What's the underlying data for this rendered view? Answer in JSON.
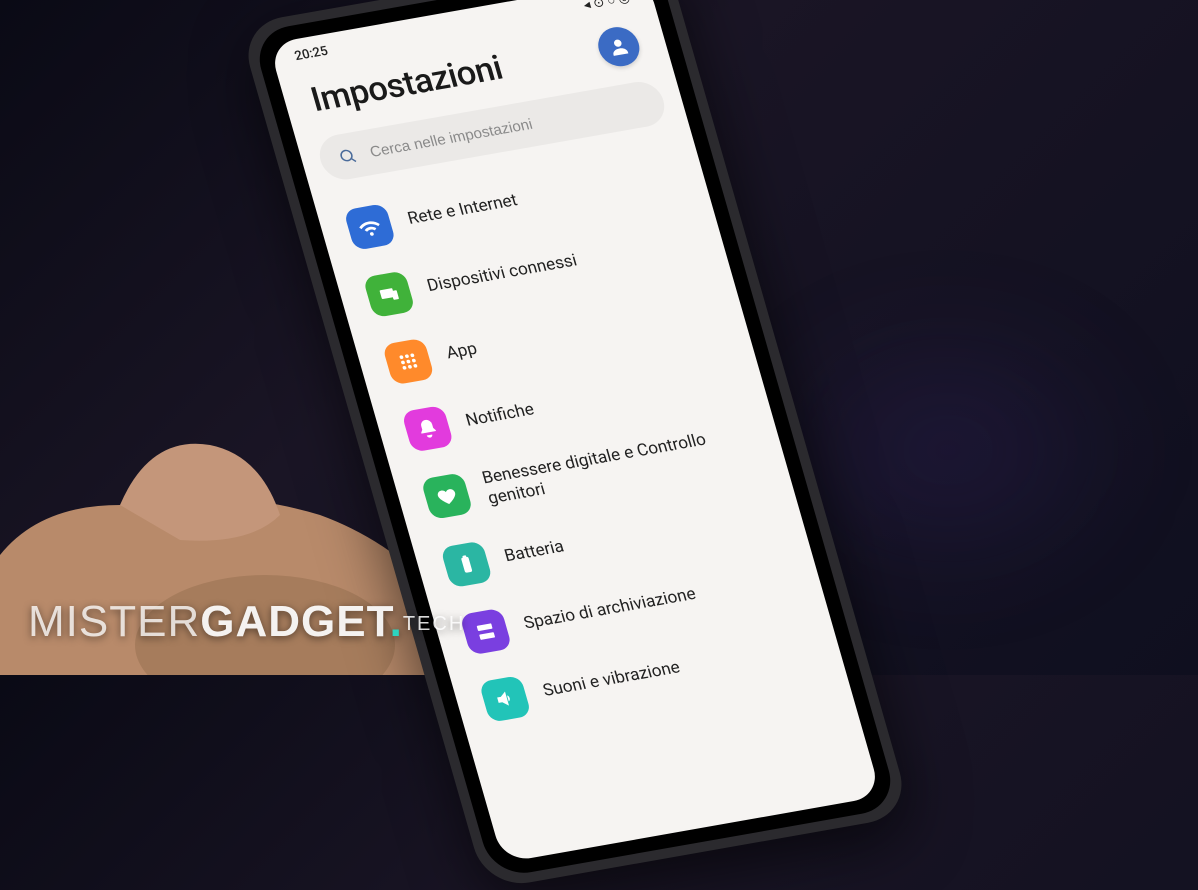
{
  "status": {
    "time": "20:25",
    "indicators": "◂ ⊙ ○ ◎"
  },
  "header": {
    "title": "Impostazioni"
  },
  "search": {
    "placeholder": "Cerca nelle impostazioni"
  },
  "items": [
    {
      "label": "Rete e Internet",
      "icon": "wifi-icon",
      "color": "#2e6cd6"
    },
    {
      "label": "Dispositivi connessi",
      "icon": "devices-icon",
      "color": "#40b23a"
    },
    {
      "label": "App",
      "icon": "apps-icon",
      "color": "#ff8a2b"
    },
    {
      "label": "Notifiche",
      "icon": "bell-icon",
      "color": "#e23bdd"
    },
    {
      "label": "Benessere digitale e Controllo genitori",
      "icon": "wellbeing-icon",
      "color": "#29b35c"
    },
    {
      "label": "Batteria",
      "icon": "battery-icon",
      "color": "#2bb6a3"
    },
    {
      "label": "Spazio di archiviazione",
      "icon": "storage-icon",
      "color": "#7a3fe0"
    },
    {
      "label": "Suoni e vibrazione",
      "icon": "sound-icon",
      "color": "#22c4b8"
    }
  ],
  "watermark": {
    "part1": "MISTER",
    "part2": "GADGET",
    "dot": ".",
    "part3": "TECH"
  }
}
